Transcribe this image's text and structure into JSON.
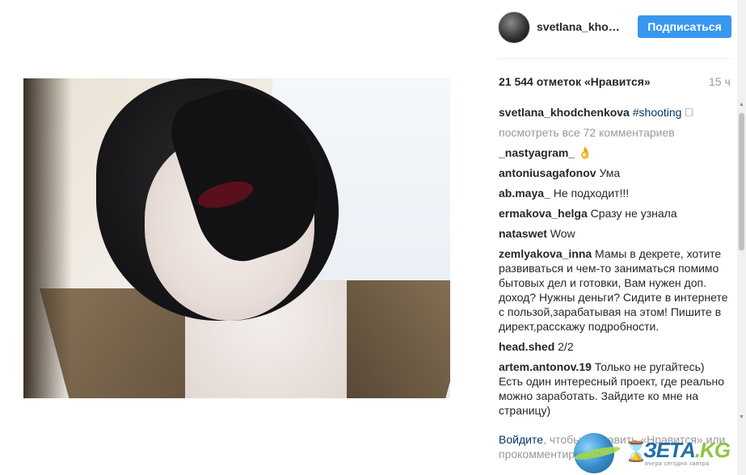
{
  "header": {
    "username": "svetlana_kho…",
    "follow_label": "Подписаться"
  },
  "post": {
    "likes": "21 544 отметок «Нравится»",
    "time": "15 ч"
  },
  "caption": {
    "user": "svetlana_khodchenkova",
    "hashtag": "#shooting",
    "extra": " 🗆"
  },
  "view_all": "посмотреть все 72 комментариев",
  "comments": [
    {
      "user": "_nastyagram_",
      "text": " 👌"
    },
    {
      "user": "antoniusagafonov",
      "text": " Ума"
    },
    {
      "user": "ab.maya_",
      "text": " Не подходит!!!"
    },
    {
      "user": "ermakova_helga",
      "text": " Сразу не узнала"
    },
    {
      "user": "nataswet",
      "text": " Wow"
    },
    {
      "user": "zemlyakova_inna",
      "text": " Мамы в декрете, хотите развиваться и чем-то заниматься помимо бытовых дел и готовки, Вам нужен доп. доход? Нужны деньги? Сидите в интернете с пользой,зарабатывая на этом! Пишите в директ,расскажу подробности."
    },
    {
      "user": "head.shed",
      "text": " 2/2"
    },
    {
      "user": "artem.antonov.19",
      "text": " Только не ругайтесь) Есть один интересный проект, где реально можно заработать. Зайдите ко мне на страницу)"
    }
  ],
  "footer": {
    "login": "Войдите",
    "text": ", чтобы поставить «Нравится» или прокомментировать."
  },
  "watermark": {
    "brand": "ЗЕТА",
    "tld": ".KG",
    "tagline": "вчера сегодня завтра"
  },
  "icons": {
    "scroll_up": "▲",
    "scroll_down": "▼",
    "hourglass": "⌛"
  },
  "colors": {
    "follow_button": "#3897f0",
    "link": "#003569",
    "muted": "#999999"
  }
}
